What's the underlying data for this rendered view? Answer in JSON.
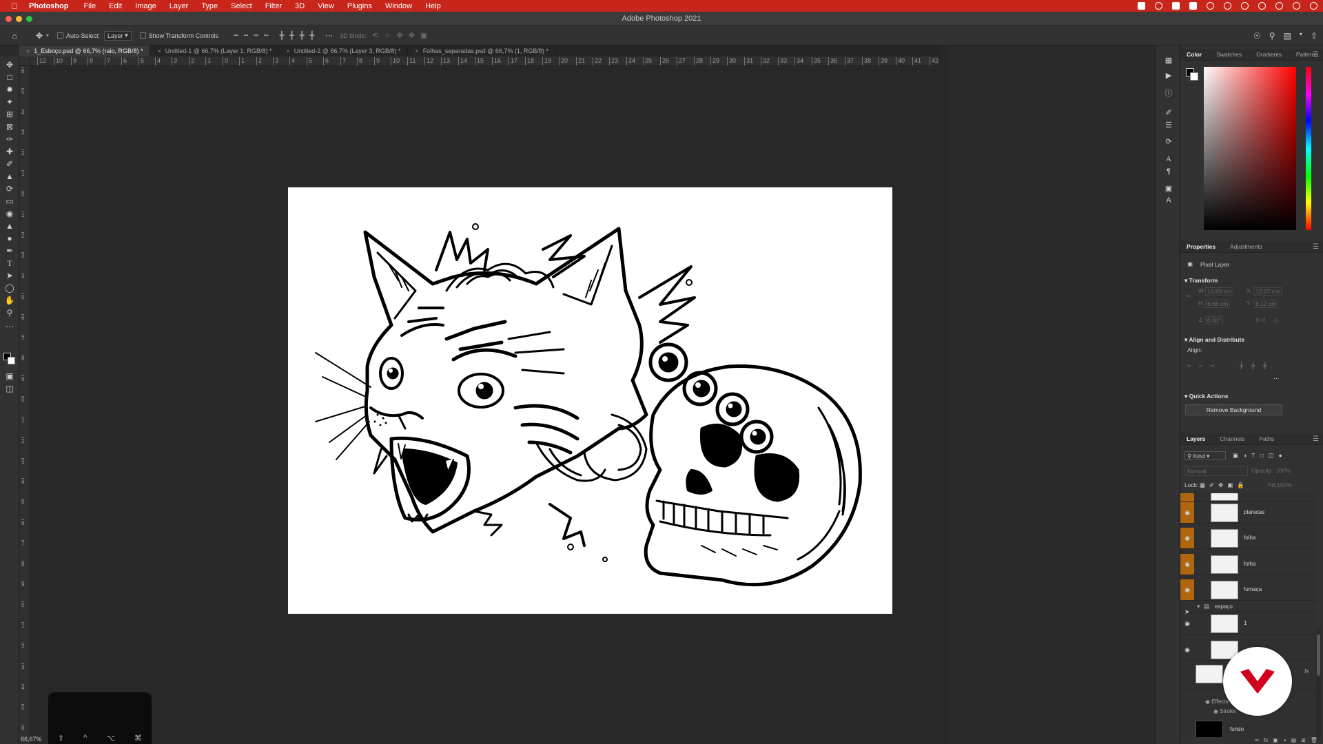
{
  "menubar": {
    "app_name": "Photoshop",
    "items": [
      "File",
      "Edit",
      "Image",
      "Layer",
      "Type",
      "Select",
      "Filter",
      "3D",
      "View",
      "Plugins",
      "Window",
      "Help"
    ]
  },
  "window": {
    "title": "Adobe Photoshop 2021"
  },
  "options_bar": {
    "auto_select_label": "Auto-Select:",
    "auto_select_value": "Layer",
    "transform_controls_label": "Show Transform Controls",
    "mode_3d_label": "3D Mode:"
  },
  "tabs": [
    {
      "label": "1_Esboço.psd @ 66,7% (raio, RGB/8) *",
      "active": true
    },
    {
      "label": "Untitled-1 @ 66,7% (Layer 1, RGB/8) *",
      "active": false
    },
    {
      "label": "Untitled-2 @ 66,7% (Layer 3, RGB/8) *",
      "active": false
    },
    {
      "label": "Folhas_separadas.psd @ 66,7% (1, RGB/8) *",
      "active": false
    }
  ],
  "ruler": {
    "horizontal": [
      "12",
      "10",
      "9",
      "8",
      "7",
      "6",
      "5",
      "4",
      "3",
      "2",
      "1",
      "0",
      "1",
      "2",
      "3",
      "4",
      "5",
      "6",
      "7",
      "8",
      "9",
      "10",
      "11",
      "12",
      "13",
      "14",
      "15",
      "16",
      "17",
      "18",
      "19",
      "20",
      "21",
      "22",
      "23",
      "24",
      "25",
      "26",
      "27",
      "28",
      "29",
      "30",
      "31",
      "32",
      "33",
      "34",
      "35",
      "36",
      "37",
      "38",
      "39",
      "40",
      "41",
      "42"
    ],
    "vertical": [
      "6",
      "5",
      "4",
      "3",
      "2",
      "1",
      "0",
      "1",
      "2",
      "3",
      "4",
      "5",
      "6",
      "7",
      "8",
      "9",
      "0",
      "1",
      "2",
      "3",
      "4",
      "5",
      "6",
      "7",
      "8",
      "9",
      "0",
      "1",
      "2",
      "3",
      "4",
      "5",
      "6"
    ]
  },
  "status": {
    "zoom": "66,67%"
  },
  "touchbar_keys": [
    "⇧",
    "^",
    "⌥",
    "⌘"
  ],
  "color_panel": {
    "tabs": [
      "Color",
      "Swatches",
      "Gradients",
      "Patterns"
    ],
    "foreground": "#000000",
    "background": "#ffffff",
    "hue_selected": "#ff0000"
  },
  "properties_panel": {
    "tabs": [
      "Properties",
      "Adjustments"
    ],
    "layer_type": "Pixel Layer",
    "transform_title": "Transform",
    "w_label": "W",
    "w_value": "10,93 cm",
    "x_label": "X",
    "x_value": "12,07 cm",
    "h_label": "H",
    "h_value": "6,68 cm",
    "y_label": "Y",
    "y_value": "8,12 cm",
    "angle_value": "0,00°",
    "align_title": "Align and Distribute",
    "align_label": "Align:",
    "quick_actions_title": "Quick Actions",
    "remove_background": "Remove Background"
  },
  "layers_panel": {
    "tabs": [
      "Layers",
      "Channels",
      "Paths"
    ],
    "filter_kind": "Kind",
    "blend_mode": "Normal",
    "opacity_label": "Opacity:",
    "opacity_value": "100%",
    "lock_label": "Lock:",
    "fill_label": "Fill:",
    "fill_value": "100%",
    "layers": [
      {
        "name": "planetas",
        "highlight": true
      },
      {
        "name": "folha",
        "highlight": true
      },
      {
        "name": "folha",
        "highlight": true
      },
      {
        "name": "fumaça",
        "highlight": true
      }
    ],
    "group_name": "espaço",
    "group_layers": [
      {
        "name": "1"
      },
      {
        "name": ""
      }
    ],
    "effects_label": "Effects",
    "stroke_label": "Stroke",
    "bottom_layer_name": "fundo",
    "fx_label": "fx"
  },
  "colors": {
    "menubar": "#c8261b",
    "highlight_layer": "#b0660e",
    "logo": "#d0021b"
  }
}
